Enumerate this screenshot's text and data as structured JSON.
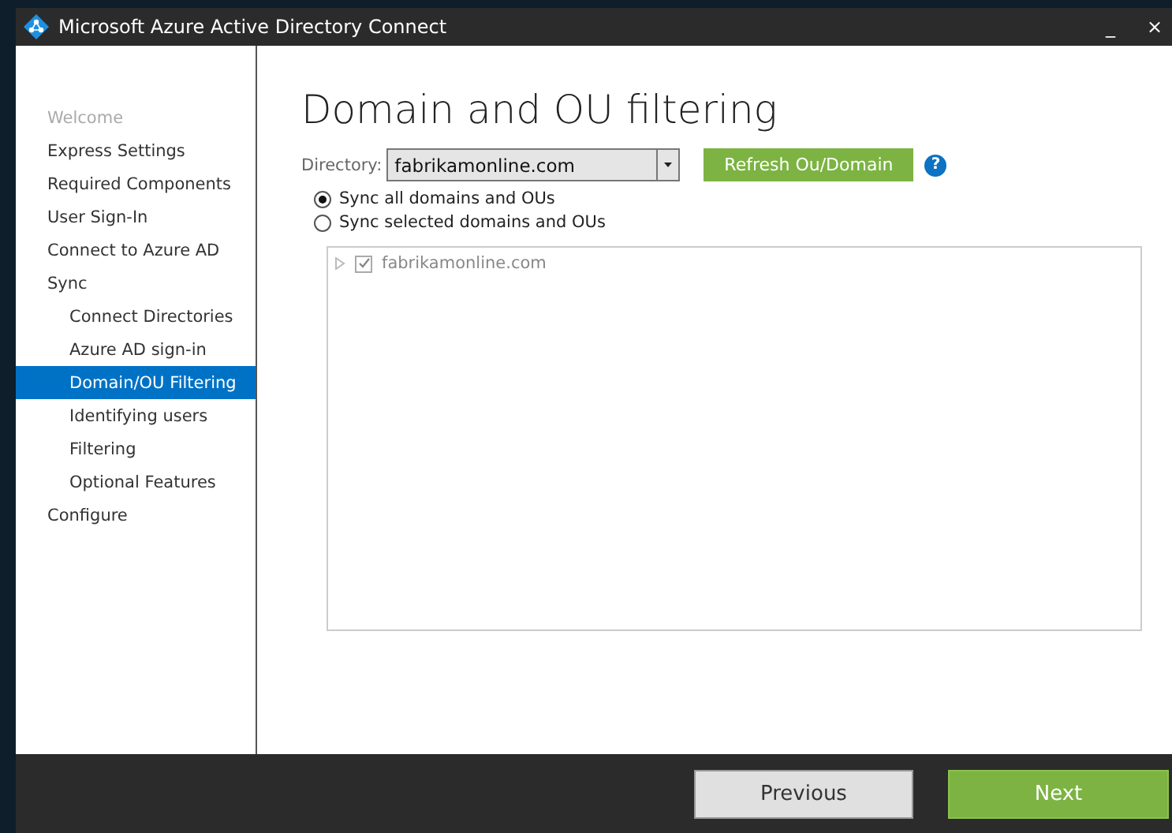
{
  "window": {
    "title": "Microsoft Azure Active Directory Connect",
    "controls": [
      "_",
      "×"
    ]
  },
  "sidebar": {
    "items": [
      {
        "label": "Welcome",
        "disabled": true,
        "selected": false
      },
      {
        "label": "Express Settings",
        "disabled": false,
        "selected": false
      },
      {
        "label": "Required Components",
        "disabled": false,
        "selected": false
      },
      {
        "label": "User Sign-In",
        "disabled": false,
        "selected": false
      },
      {
        "label": "Connect to Azure AD",
        "disabled": false,
        "selected": false
      },
      {
        "label": "Sync",
        "disabled": false,
        "selected": false,
        "children": [
          {
            "label": "Connect Directories",
            "disabled": false,
            "selected": false
          },
          {
            "label": "Azure AD sign-in",
            "disabled": false,
            "selected": false
          },
          {
            "label": "Domain/OU Filtering",
            "disabled": false,
            "selected": true
          },
          {
            "label": "Identifying users",
            "disabled": false,
            "selected": false
          },
          {
            "label": "Filtering",
            "disabled": false,
            "selected": false
          },
          {
            "label": "Optional Features",
            "disabled": false,
            "selected": false
          }
        ]
      },
      {
        "label": "Configure",
        "disabled": false,
        "selected": false
      }
    ]
  },
  "page": {
    "heading": "Domain and OU filtering",
    "directory": {
      "label": "Directory:",
      "value": "fabrikamonline.com"
    },
    "refresh_button": "Refresh Ou/Domain",
    "help": "?",
    "options": [
      {
        "label": "Sync all domains and OUs",
        "selected": true
      },
      {
        "label": "Sync selected domains and OUs",
        "selected": false
      }
    ],
    "tree": {
      "disabled": true,
      "items": [
        {
          "label": "fabrikamonline.com",
          "checked": true,
          "expanded": false
        }
      ]
    }
  },
  "footer": {
    "buttons": [
      {
        "label": "Previous",
        "kind": "secondary"
      },
      {
        "label": "Next",
        "kind": "primary"
      }
    ]
  }
}
